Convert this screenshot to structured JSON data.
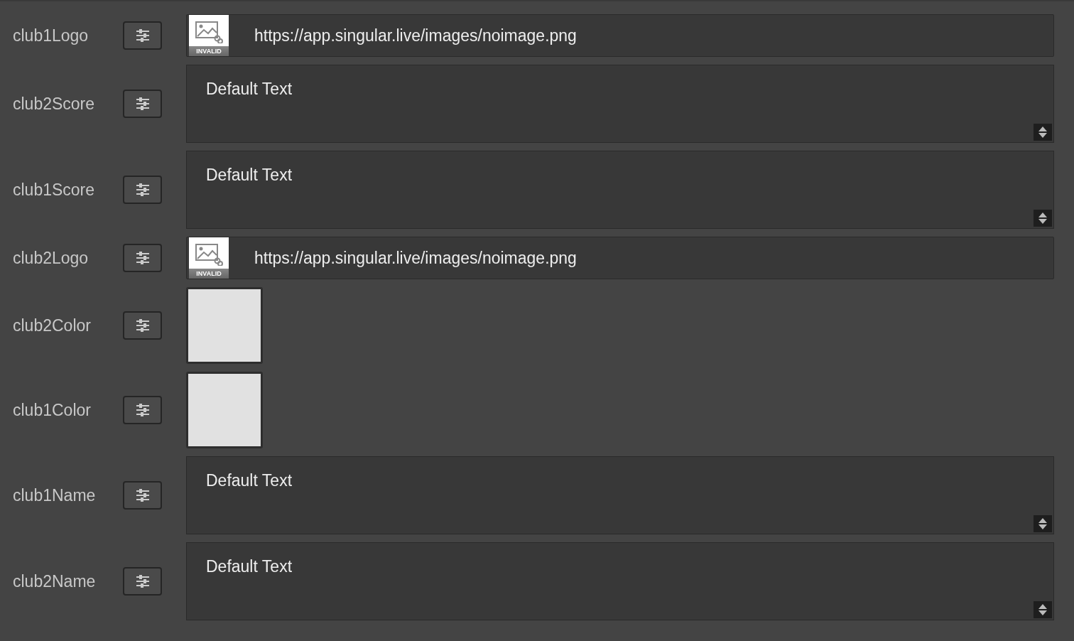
{
  "fields": [
    {
      "label": "club1Logo",
      "kind": "image",
      "badge": "INVALID",
      "value": "https://app.singular.live/images/noimage.png"
    },
    {
      "label": "club2Score",
      "kind": "text",
      "value": "Default Text"
    },
    {
      "label": "club1Score",
      "kind": "text",
      "value": "Default Text"
    },
    {
      "label": "club2Logo",
      "kind": "image",
      "badge": "INVALID",
      "value": "https://app.singular.live/images/noimage.png"
    },
    {
      "label": "club2Color",
      "kind": "color",
      "color": "#e1e1e1"
    },
    {
      "label": "club1Color",
      "kind": "color",
      "color": "#e1e1e1"
    },
    {
      "label": "club1Name",
      "kind": "text",
      "value": "Default Text"
    },
    {
      "label": "club2Name",
      "kind": "text",
      "value": "Default Text"
    }
  ]
}
